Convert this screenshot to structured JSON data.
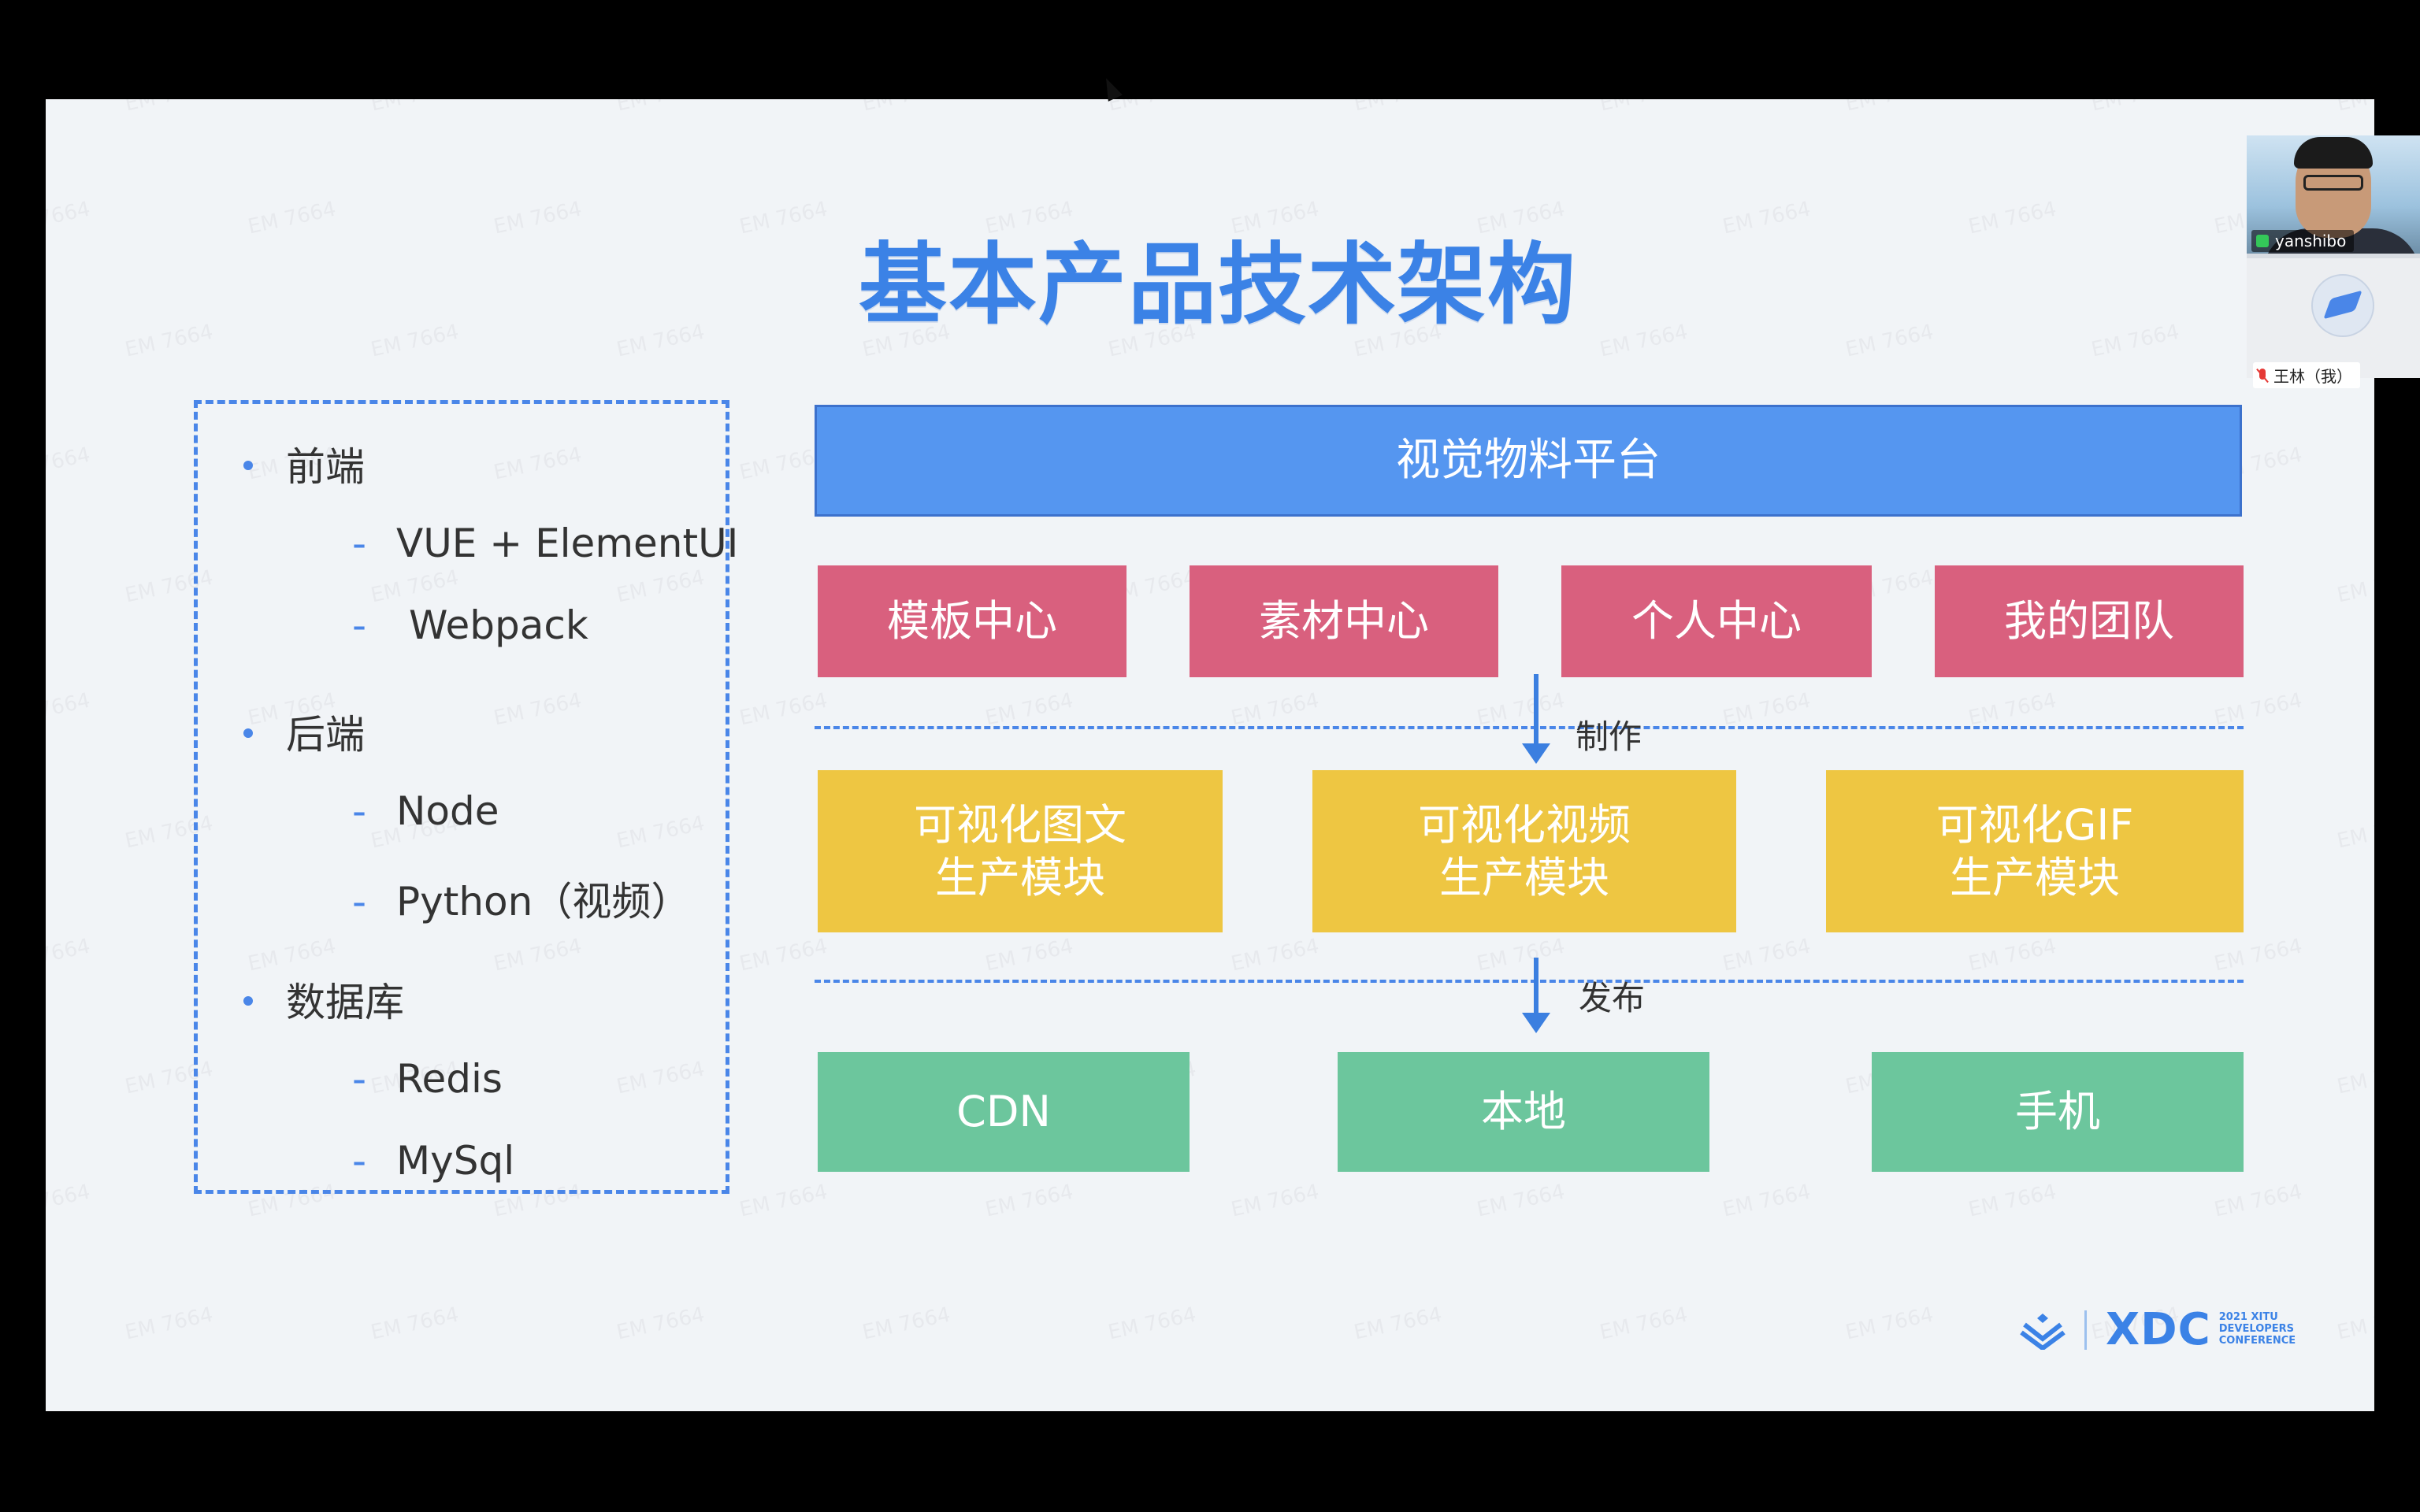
{
  "slide": {
    "title": "基本产品技术架构",
    "tech_stack": [
      {
        "category": "前端",
        "items": [
          "VUE + ElementUI",
          "Webpack"
        ]
      },
      {
        "category": "后端",
        "items": [
          "Node",
          "Python（视频）"
        ]
      },
      {
        "category": "数据库",
        "items": [
          "Redis",
          "MySql"
        ]
      }
    ],
    "architecture": {
      "platform": "视觉物料平台",
      "centers": [
        "模板中心",
        "素材中心",
        "个人中心",
        "我的团队"
      ],
      "step1_label": "制作",
      "modules": [
        "可视化图文\n生产模块",
        "可视化视频\n生产模块",
        "可视化GIF\n生产模块"
      ],
      "step2_label": "发布",
      "targets": [
        "CDN",
        "本地",
        "手机"
      ]
    },
    "logo": {
      "text": "XDC",
      "sub_lines": [
        "2021 XITU",
        "DEVELOPERS",
        "CONFERENCE"
      ]
    },
    "watermark": "EM 7664"
  },
  "participants": [
    {
      "name": "yanshibo",
      "mic": "on"
    },
    {
      "name": "王林（我）",
      "mic": "off"
    }
  ],
  "colors": {
    "accent_blue": "#3b82e6",
    "platform_blue": "#5596f0",
    "pink": "#d9607e",
    "yellow": "#eec642",
    "green": "#6cc69d"
  }
}
